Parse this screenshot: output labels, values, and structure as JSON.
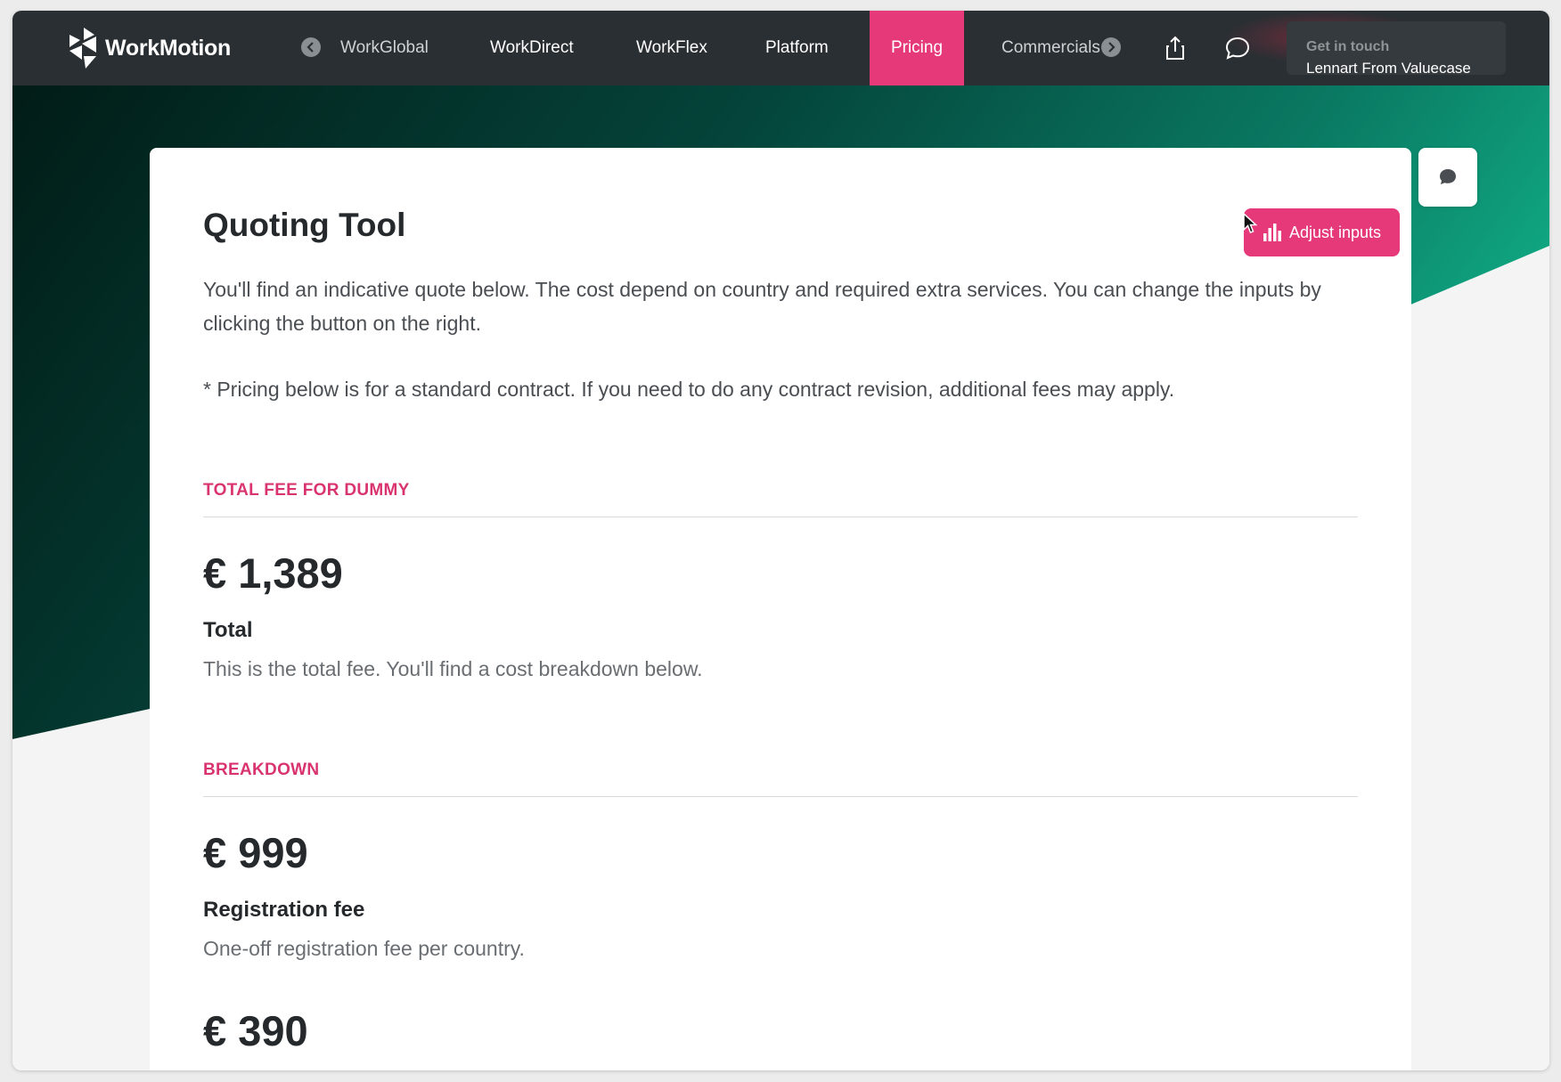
{
  "app": {
    "logo_text": "WorkMotion"
  },
  "nav": {
    "items": [
      {
        "label": "WorkGlobal"
      },
      {
        "label": "WorkDirect"
      },
      {
        "label": "WorkFlex"
      },
      {
        "label": "Platform"
      },
      {
        "label": "Pricing",
        "active": true
      },
      {
        "label": "Commercials"
      }
    ],
    "contact": {
      "top": "Get in touch",
      "bottom": "Lennart From Valuecase"
    }
  },
  "quote": {
    "title": "Quoting Tool",
    "adjust_button": "Adjust inputs",
    "intro": "You'll find an indicative quote below. The cost depend on country and required extra services. You can change the inputs by clicking the button on the right.",
    "note": "* Pricing below is for a standard contract. If you need to do any contract revision, additional fees may apply.",
    "total_section": "TOTAL FEE FOR DUMMY",
    "total": {
      "amount": "€ 1,389",
      "label": "Total",
      "description": "This is the total fee. You'll find a cost breakdown below."
    },
    "breakdown_section": "BREAKDOWN",
    "breakdown": [
      {
        "amount": "€ 999",
        "label": "Registration fee",
        "description": "One-off registration fee per country."
      },
      {
        "amount": "€ 390"
      }
    ]
  },
  "colors": {
    "accent": "#e6397a",
    "nav_bg": "#2a2f33",
    "teal": "#0fa37f"
  },
  "icons": [
    "chevron-left-icon",
    "chevron-right-icon",
    "share-icon",
    "chat-icon",
    "bar-chart-icon"
  ]
}
